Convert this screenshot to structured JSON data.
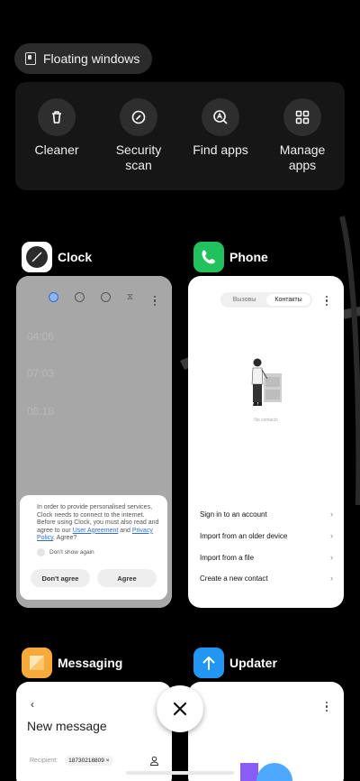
{
  "floating_windows": {
    "label": "Floating windows",
    "icon": "floating-window-icon"
  },
  "tools": [
    {
      "label": "Cleaner",
      "icon": "trash-icon"
    },
    {
      "label": "Security\nscan",
      "icon": "security-scan-icon"
    },
    {
      "label": "Find apps",
      "icon": "find-apps-icon"
    },
    {
      "label": "Manage\napps",
      "icon": "grid-icon"
    }
  ],
  "apps": {
    "clock": {
      "name": "Clock",
      "ghost_rows": [
        "04:06",
        "07:03",
        "08:18"
      ],
      "dialog": {
        "message_part1": "In order to provide personalised services, Clock needs to connect to the internet. Before using Clock, you must also read and agree to our ",
        "link1": "User Agreement",
        "and": " and ",
        "link2": "Privacy Policy",
        "message_part2": ". Agree?",
        "checkbox": "Don't show again",
        "decline": "Don't agree",
        "accept": "Agree"
      }
    },
    "phone": {
      "name": "Phone",
      "tabs": [
        "Вызовы",
        "Контакты"
      ],
      "empty_text": "No contacts",
      "options": [
        "Sign in to an account",
        "Import from an older device",
        "Import from a file",
        "Create a new contact"
      ]
    },
    "messaging": {
      "name": "Messaging",
      "back": "‹",
      "title": "New message",
      "recipient_label": "Recipient:",
      "recipient_value": "18730218809 ×"
    },
    "updater": {
      "name": "Updater"
    }
  },
  "colors": {
    "phone_green": "#21c25e",
    "messaging_orange": "#f7a93a",
    "updater_blue": "#2196f3",
    "link_blue": "#2d6fd6"
  }
}
